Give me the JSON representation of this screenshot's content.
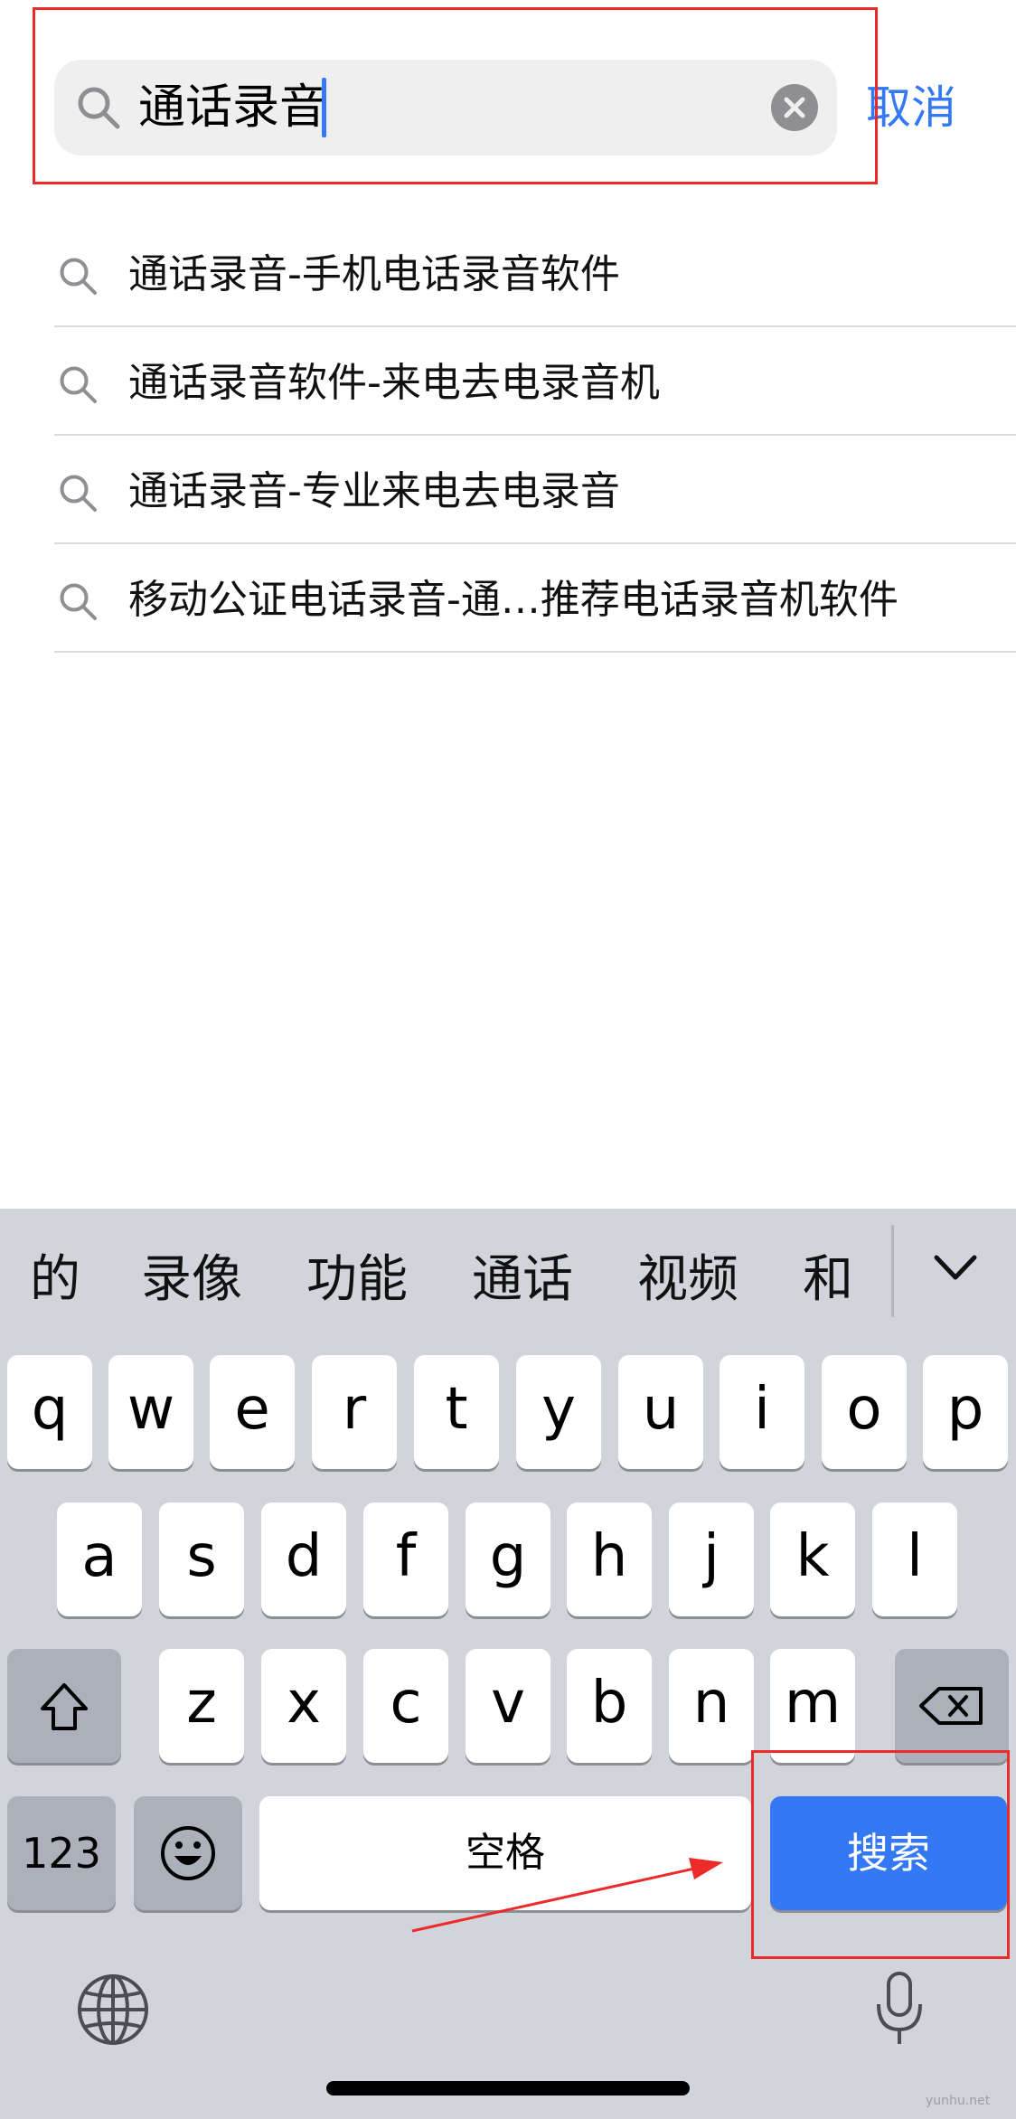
{
  "search": {
    "query": "通话录音",
    "cancel_label": "取消"
  },
  "suggestions": [
    {
      "text": "通话录音-手机电话录音软件"
    },
    {
      "text": "通话录音软件-来电去电录音机"
    },
    {
      "text": "通话录音-专业来电去电录音"
    },
    {
      "text": "移动公证电话录音-通…推荐电话录音机软件"
    }
  ],
  "keyboard": {
    "candidates": [
      "的",
      "录像",
      "功能",
      "通话",
      "视频",
      "和"
    ],
    "row1": [
      "q",
      "w",
      "e",
      "r",
      "t",
      "y",
      "u",
      "i",
      "o",
      "p"
    ],
    "row2": [
      "a",
      "s",
      "d",
      "f",
      "g",
      "h",
      "j",
      "k",
      "l"
    ],
    "row3": [
      "z",
      "x",
      "c",
      "v",
      "b",
      "n",
      "m"
    ],
    "num_label": "123",
    "space_label": "空格",
    "search_label": "搜索",
    "icons": {
      "shift": "shift-icon",
      "backspace": "backspace-icon",
      "emoji": "emoji-icon",
      "globe": "globe-icon",
      "mic": "microphone-icon",
      "collapse": "chevron-down-icon"
    }
  },
  "colors": {
    "accent": "#3478f6",
    "keyboard_bg": "#d1d4da",
    "func_key": "#abb0ba",
    "annotation": "#ec2a2a"
  },
  "watermark": "yunhu.net"
}
